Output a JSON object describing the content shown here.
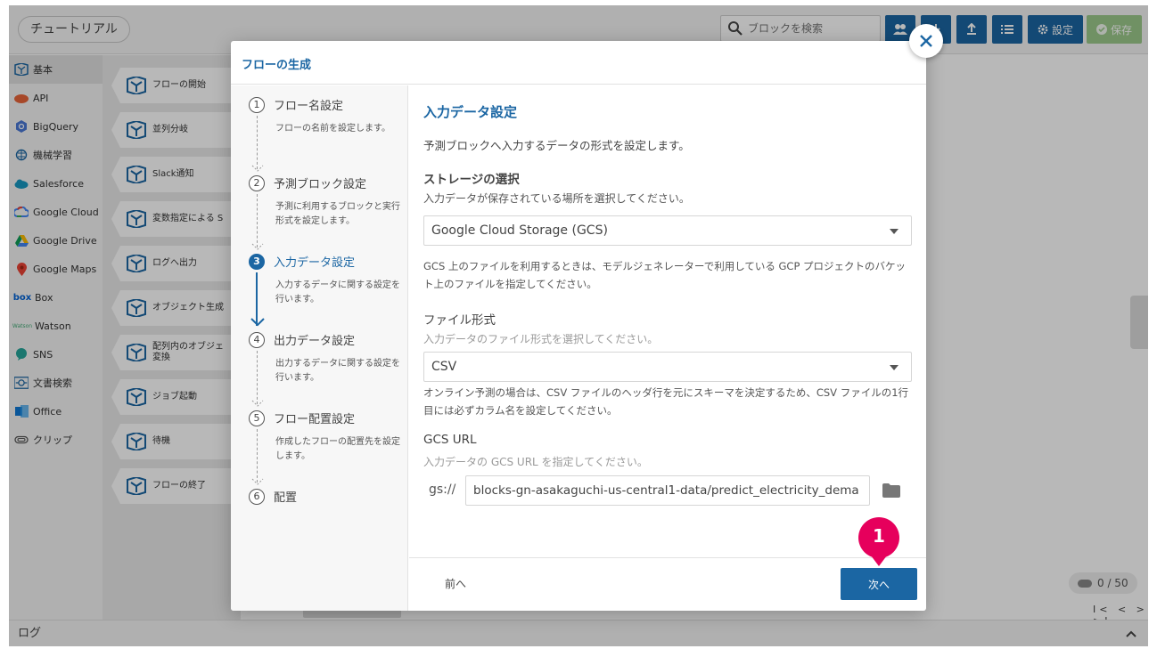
{
  "app": {
    "tutorial_label": "チュートリアル",
    "search_placeholder": "ブロックを検索",
    "settings_label": "設定",
    "save_label": "保存",
    "counter": "0 / 50",
    "pager": "I< < > >I",
    "log_label": "ログ"
  },
  "sidebar": {
    "items": [
      {
        "label": "基本",
        "icon": "cube-icon"
      },
      {
        "label": "API",
        "icon": "api-icon"
      },
      {
        "label": "BigQuery",
        "icon": "bigquery-icon"
      },
      {
        "label": "機械学習",
        "icon": "brain-icon"
      },
      {
        "label": "Salesforce",
        "icon": "cloud-icon"
      },
      {
        "label": "Google Cloud",
        "icon": "google-cloud-icon"
      },
      {
        "label": "Google Drive",
        "icon": "google-drive-icon"
      },
      {
        "label": "Google Maps",
        "icon": "map-pin-icon"
      },
      {
        "label": "Box",
        "icon": "box-icon"
      },
      {
        "label": "Watson",
        "icon": "watson-icon"
      },
      {
        "label": "SNS",
        "icon": "chat-bubble-icon"
      },
      {
        "label": "文書検索",
        "icon": "document-search-icon"
      },
      {
        "label": "Office",
        "icon": "office-icon"
      },
      {
        "label": "クリップ",
        "icon": "paperclip-icon"
      }
    ]
  },
  "blocks": [
    "フローの開始",
    "並列分岐",
    "Slack通知",
    "変数指定による S",
    "ログへ出力",
    "オブジェクト生成",
    "配列内のオブジェ 変換",
    "ジョブ起動",
    "待機",
    "フローの終了"
  ],
  "modal": {
    "title": "フローの生成",
    "steps": [
      {
        "num": "1",
        "label": "フロー名設定",
        "desc": "フローの名前を設定します。"
      },
      {
        "num": "2",
        "label": "予測ブロック設定",
        "desc": "予測に利用するブロックと実行形式を設定します。"
      },
      {
        "num": "3",
        "label": "入力データ設定",
        "desc": "入力するデータに関する設定を行います。"
      },
      {
        "num": "4",
        "label": "出力データ設定",
        "desc": "出力するデータに関する設定を行います。"
      },
      {
        "num": "5",
        "label": "フロー配置設定",
        "desc": "作成したフローの配置先を設定します。"
      },
      {
        "num": "6",
        "label": "配置",
        "desc": ""
      }
    ],
    "section_title": "入力データ設定",
    "section_desc": "予測ブロックへ入力するデータの形式を設定します。",
    "storage_title": "ストレージの選択",
    "storage_hint": "入力データが保存されている場所を選択してください。",
    "storage_value": "Google Cloud Storage (GCS)",
    "storage_note": "GCS 上のファイルを利用するときは、モデルジェネレーターで利用している GCP プロジェクトのバケット上のファイルを指定してください。",
    "format_title": "ファイル形式",
    "format_hint": "入力データのファイル形式を選択してください。",
    "format_value": "CSV",
    "format_note": "オンライン予測の場合は、CSV ファイルのヘッダ行を元にスキーマを決定するため、CSV ファイルの1行目には必ずカラム名を設定してください。",
    "url_title": "GCS URL",
    "url_hint": "入力データの GCS URL を指定してください。",
    "url_prefix": "gs://",
    "url_value": "blocks-gn-asakaguchi-us-central1-data/predict_electricity_dema",
    "prev_label": "前へ",
    "next_label": "次へ",
    "callout_number": "1"
  },
  "colors": {
    "primary": "#1b66a3",
    "callout": "#e6005c",
    "save": "#9cc98b"
  }
}
